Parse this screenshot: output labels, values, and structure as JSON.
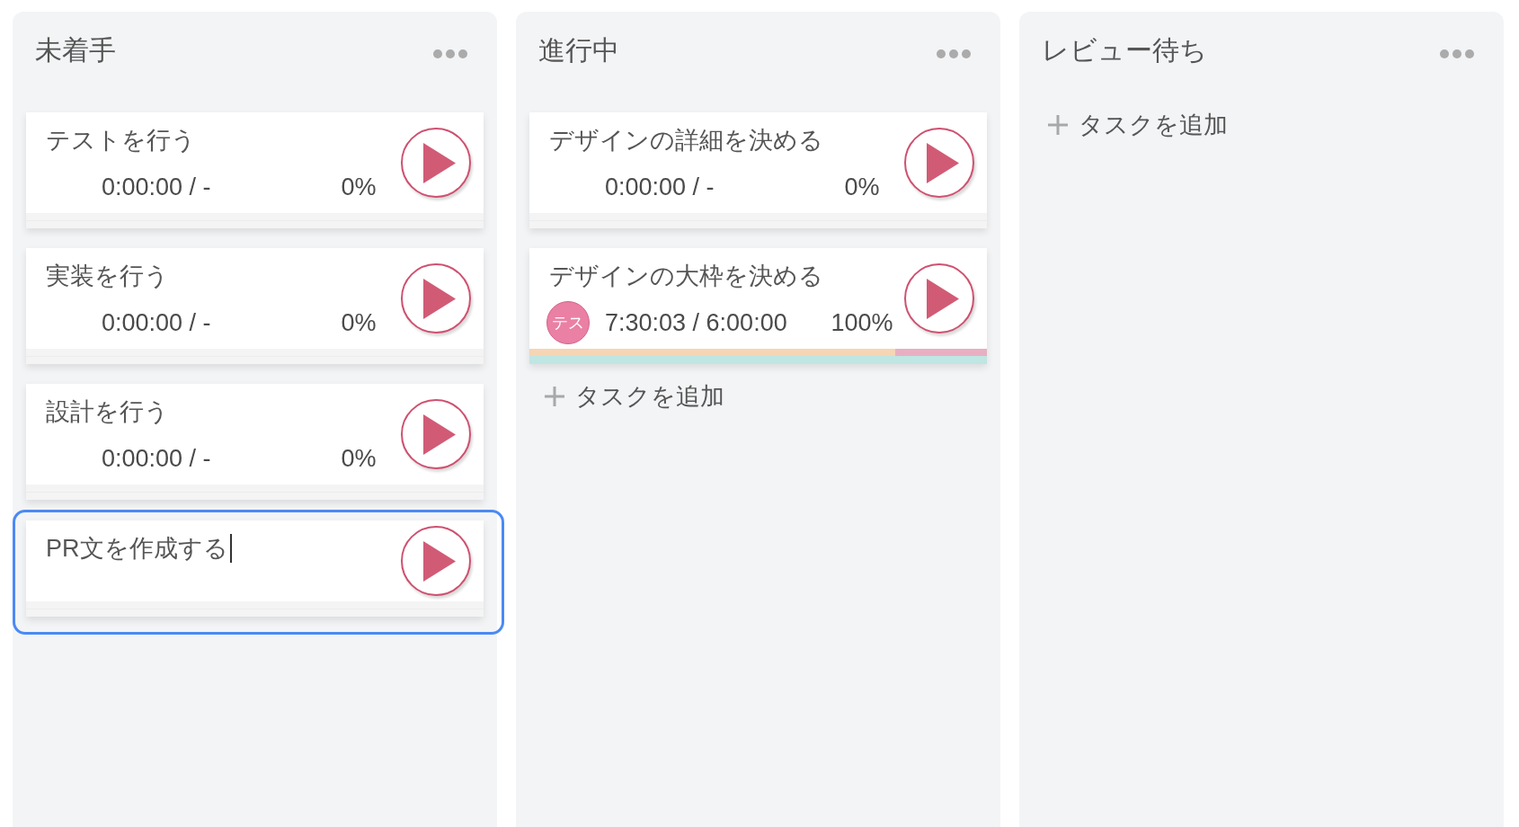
{
  "columns": [
    {
      "title": "未着手",
      "cards": [
        {
          "title": "テストを行う",
          "editing": false,
          "time": "0:00:00 / -",
          "percent": "0%",
          "time_bar": {
            "level": 0,
            "overtime": false
          },
          "progress_bar": {
            "level": 0
          }
        },
        {
          "title": "実装を行う",
          "editing": false,
          "time": "0:00:00 / -",
          "percent": "0%",
          "time_bar": {
            "level": 0,
            "overtime": false
          },
          "progress_bar": {
            "level": 0
          }
        },
        {
          "title": "設計を行う",
          "editing": false,
          "time": "0:00:00 / -",
          "percent": "0%",
          "time_bar": {
            "level": 0,
            "overtime": false
          },
          "progress_bar": {
            "level": 0
          }
        },
        {
          "title": "PR文を作成する",
          "editing": true,
          "time_bar": {
            "level": 0,
            "overtime": false
          },
          "progress_bar": {
            "level": 0
          }
        }
      ]
    },
    {
      "title": "進行中",
      "cards": [
        {
          "title": "デザインの詳細を決める",
          "editing": false,
          "time": "0:00:00 / -",
          "percent": "0%",
          "time_bar": {
            "level": 0,
            "overtime": false
          },
          "progress_bar": {
            "level": 0
          }
        },
        {
          "title": "デザインの大枠を決める",
          "editing": false,
          "assignee": "テス",
          "time": "7:30:03 / 6:00:00",
          "percent": "100%",
          "time_bar": {
            "level": 0.8,
            "overtime": true
          },
          "progress_bar": {
            "level": 1
          }
        }
      ],
      "add_task": "タスクを追加"
    },
    {
      "title": "レビュー待ち",
      "add_task": "タスクを追加"
    }
  ]
}
